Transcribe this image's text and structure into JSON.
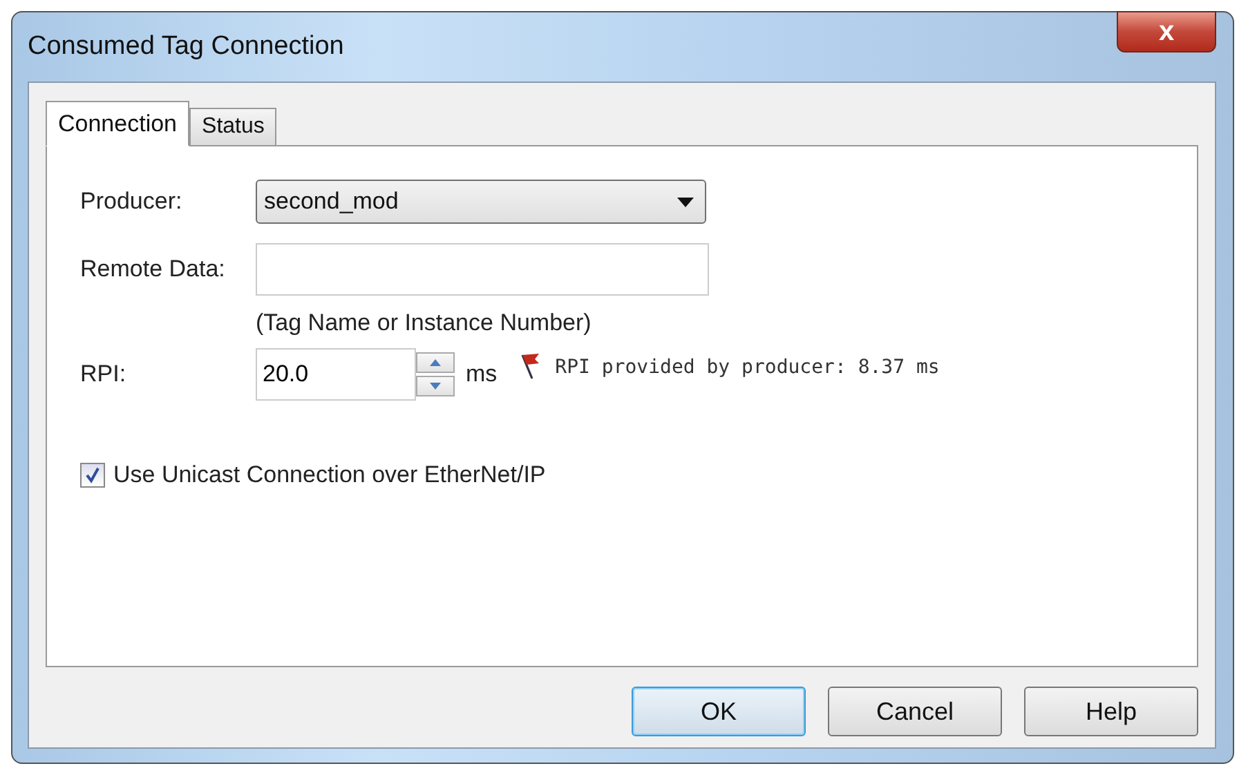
{
  "window": {
    "title": "Consumed Tag Connection",
    "close_label": "x"
  },
  "tabs": [
    {
      "label": "Connection",
      "selected": true
    },
    {
      "label": "Status",
      "selected": false
    }
  ],
  "producer": {
    "label": "Producer:",
    "value": "second_mod"
  },
  "remote_data": {
    "label": "Remote Data:",
    "hint": "(Tag Name or Instance Number)"
  },
  "rpi": {
    "label": "RPI:",
    "value": "20.0",
    "unit": "ms",
    "note": "RPI provided by producer: 8.37 ms"
  },
  "unicast": {
    "label": "Use Unicast Connection over EtherNet/IP",
    "checked": true
  },
  "buttons": [
    {
      "label": "OK",
      "kind": "default"
    },
    {
      "label": "Cancel",
      "kind": "normal"
    },
    {
      "label": "Help",
      "kind": "normal"
    }
  ]
}
